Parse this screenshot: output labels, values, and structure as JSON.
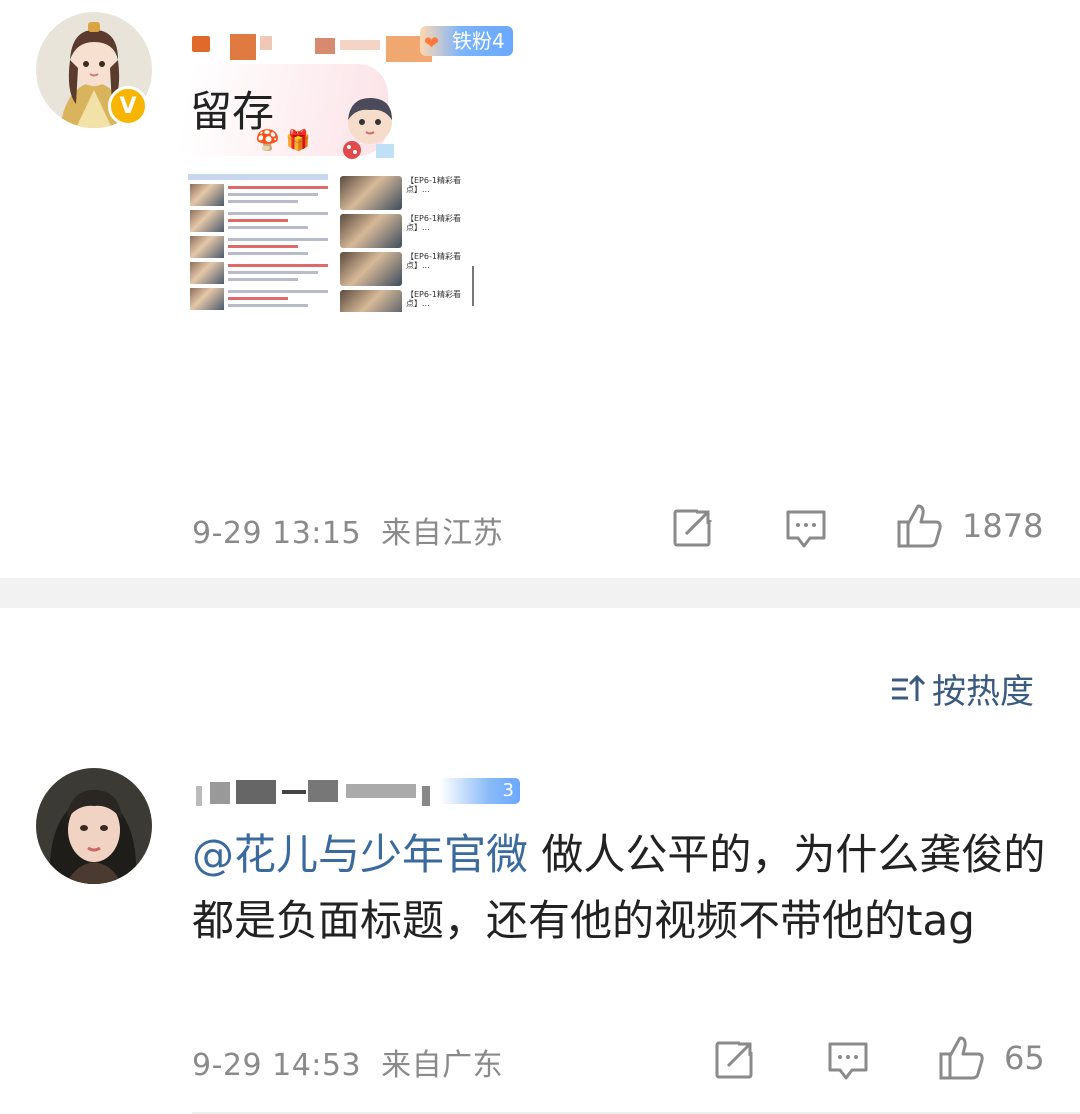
{
  "post": {
    "author_badge": "铁粉4",
    "verified_badge": "V",
    "text": "留存",
    "timestamp": "9-29 13:15",
    "location": "来自江苏",
    "like_count": "1878",
    "thumbnail": {
      "right_items": [
        {
          "title": "【EP6-1精彩看点】..."
        },
        {
          "title": "【EP6-1精彩看点】..."
        },
        {
          "title": "【EP6-1精彩看点】..."
        },
        {
          "title": "【EP6-1精彩看点】..."
        }
      ]
    }
  },
  "comments_header": {
    "sort_label": "按热度"
  },
  "comment": {
    "fan_level": "3",
    "mention": "@花儿与少年官微",
    "text": " 做人公平的，为什么龚俊的都是负面标题，还有他的视频不带他的tag",
    "timestamp": "9-29 14:53",
    "location": "来自广东",
    "like_count": "65"
  },
  "icons": {
    "repost": "share-icon",
    "comment": "comment-icon",
    "like": "thumbs-up-icon",
    "sort": "sort-icon"
  },
  "colors": {
    "mention": "#3a6a9e",
    "meta_gray": "#8a8a8a",
    "verified": "#f7b500",
    "fan_badge": "#6aa8ff"
  }
}
